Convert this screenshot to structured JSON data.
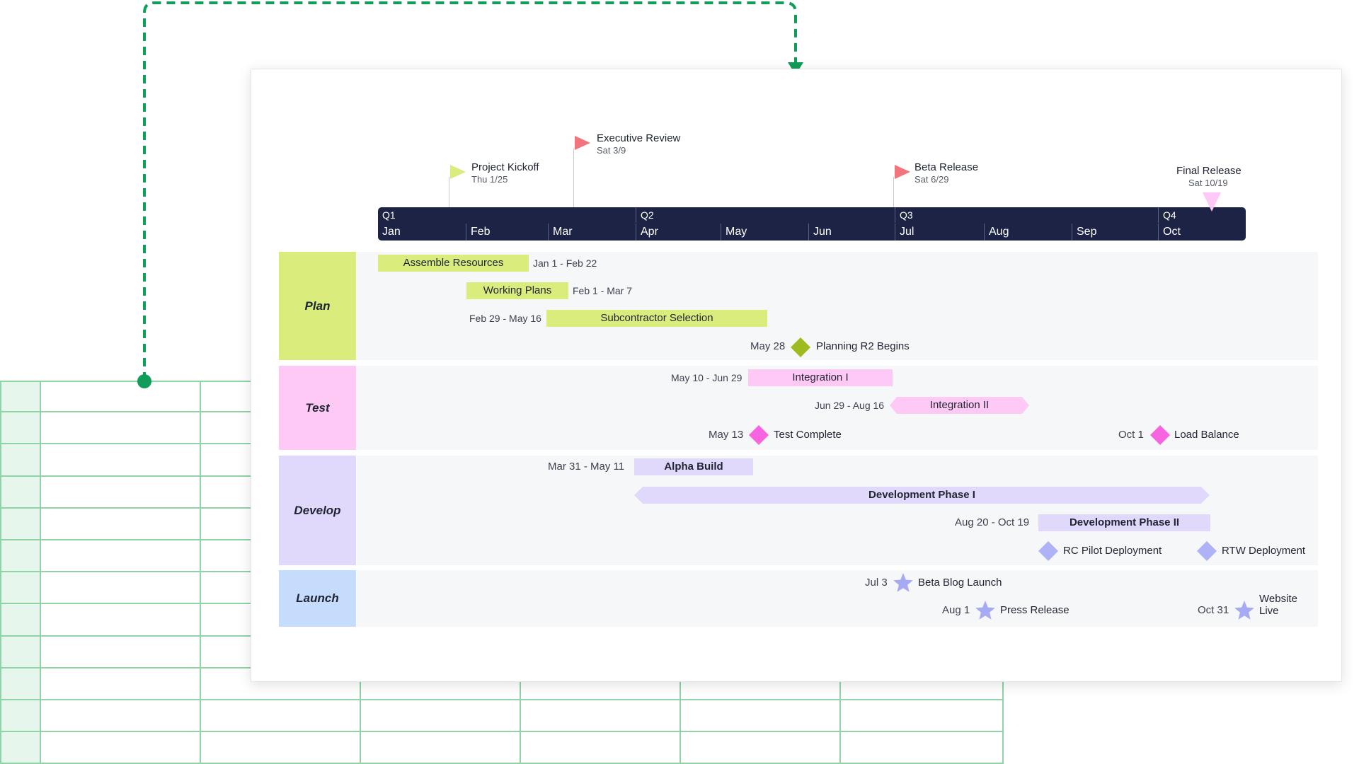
{
  "colors": {
    "plan": "#d9ec7c",
    "plan_diamond": "#9dbb1d",
    "test": "#ffc9f6",
    "test_diamond": "#f763e0",
    "develop": "#e1d9fb",
    "develop_diamond": "#aeb2f6",
    "launch": "#c6dcfc",
    "launch_star": "#a6aaf3",
    "timescale": "#1d2344",
    "connector": "#0f9d58",
    "grid": "#8fd3a7",
    "flag_green": "#d9ec7c",
    "flag_red": "#f2747c",
    "flag_pink": "#ffc9f6"
  },
  "milestones": [
    {
      "title": "Executive Review",
      "date": "Sat 3/9",
      "icon": "red-flag-icon"
    },
    {
      "title": "Project Kickoff",
      "date": "Thu 1/25",
      "icon": "green-flag-icon"
    },
    {
      "title": "Beta Release",
      "date": "Sat 6/29",
      "icon": "red-flag-icon"
    },
    {
      "title": "Final Release",
      "date": "Sat 10/19",
      "icon": "pink-triangle-icon"
    }
  ],
  "timescale": {
    "quarters": [
      "Q1",
      "Q2",
      "Q3",
      "Q4"
    ],
    "months": [
      "Jan",
      "Feb",
      "Mar",
      "Apr",
      "May",
      "Jun",
      "Jul",
      "Aug",
      "Sep",
      "Oct"
    ]
  },
  "lanes": {
    "plan": {
      "label": "Plan",
      "tasks": [
        {
          "name": "Assemble Resources",
          "date": "Jan 1 - Feb 22"
        },
        {
          "name": "Working Plans",
          "date": "Feb 1 - Mar 7"
        },
        {
          "name": "Subcontractor Selection",
          "date": "Feb 29 - May 16"
        }
      ],
      "milestones": [
        {
          "name": "Planning R2 Begins",
          "date": "May 28",
          "icon": "diamond-icon"
        }
      ]
    },
    "test": {
      "label": "Test",
      "tasks": [
        {
          "name": "Integration I",
          "date": "May 10 - Jun 29"
        },
        {
          "name": "Integration II",
          "date": "Jun 29 - Aug 16"
        }
      ],
      "milestones": [
        {
          "name": "Test Complete",
          "date": "May 13",
          "icon": "diamond-icon"
        },
        {
          "name": "Load Balance",
          "date": "Oct 1",
          "icon": "diamond-icon"
        }
      ]
    },
    "develop": {
      "label": "Develop",
      "tasks": [
        {
          "name": "Alpha Build",
          "date": "Mar 31 - May 11"
        },
        {
          "name": "Development Phase I",
          "date": ""
        },
        {
          "name": "Development Phase II",
          "date": "Aug 20 - Oct 19"
        }
      ],
      "milestones": [
        {
          "name": "RC Pilot Deployment",
          "icon": "diamond-icon"
        },
        {
          "name": "RTW Deployment",
          "icon": "diamond-icon"
        }
      ]
    },
    "launch": {
      "label": "Launch",
      "milestones": [
        {
          "name": "Beta Blog Launch",
          "date": "Jul 3",
          "icon": "star-icon"
        },
        {
          "name": "Press Release",
          "date": "Aug 1",
          "icon": "star-icon"
        },
        {
          "name_line1": "Website",
          "name_line2": "Live",
          "date": "Oct 31",
          "icon": "star-icon"
        }
      ]
    }
  }
}
